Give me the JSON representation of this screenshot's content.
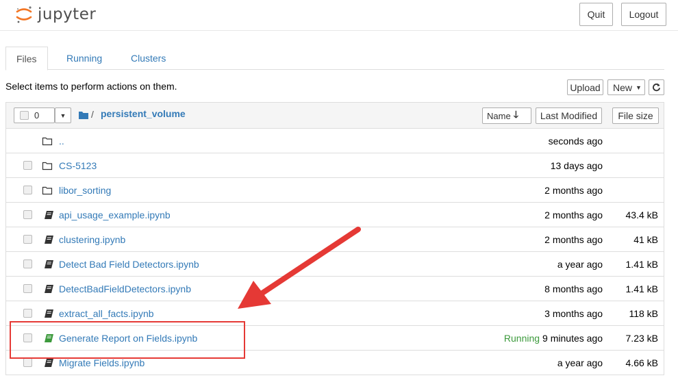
{
  "header": {
    "logo_text": "jupyter",
    "quit_label": "Quit",
    "logout_label": "Logout"
  },
  "tabs": [
    {
      "label": "Files"
    },
    {
      "label": "Running"
    },
    {
      "label": "Clusters"
    }
  ],
  "toolbar": {
    "instructions": "Select items to perform actions on them.",
    "upload_label": "Upload",
    "new_label": "New"
  },
  "list_header": {
    "selected_count": "0",
    "breadcrumb_separator": "/",
    "current_folder": "persistent_volume",
    "sort_name_label": "Name",
    "sort_modified_label": "Last Modified",
    "sort_size_label": "File size"
  },
  "rows": [
    {
      "name": "..",
      "modified": "seconds ago",
      "size": "",
      "type": "folder",
      "running": ""
    },
    {
      "name": "CS-5123",
      "modified": "13 days ago",
      "size": "",
      "type": "folder",
      "running": ""
    },
    {
      "name": "libor_sorting",
      "modified": "2 months ago",
      "size": "",
      "type": "folder",
      "running": ""
    },
    {
      "name": "api_usage_example.ipynb",
      "modified": "2 months ago",
      "size": "43.4 kB",
      "type": "notebook",
      "running": ""
    },
    {
      "name": "clustering.ipynb",
      "modified": "2 months ago",
      "size": "41 kB",
      "type": "notebook",
      "running": ""
    },
    {
      "name": "Detect Bad Field Detectors.ipynb",
      "modified": "a year ago",
      "size": "1.41 kB",
      "type": "notebook",
      "running": ""
    },
    {
      "name": "DetectBadFieldDetectors.ipynb",
      "modified": "8 months ago",
      "size": "1.41 kB",
      "type": "notebook",
      "running": ""
    },
    {
      "name": "extract_all_facts.ipynb",
      "modified": "3 months ago",
      "size": "118 kB",
      "type": "notebook",
      "running": ""
    },
    {
      "name": "Generate Report on Fields.ipynb",
      "modified": "9 minutes ago",
      "size": "7.23 kB",
      "type": "notebook-running",
      "running": "Running"
    },
    {
      "name": "Migrate Fields.ipynb",
      "modified": "a year ago",
      "size": "4.66 kB",
      "type": "notebook",
      "running": ""
    }
  ],
  "colors": {
    "link": "#337ab7",
    "running": "#3c9a3c",
    "annotation": "#e53935"
  }
}
